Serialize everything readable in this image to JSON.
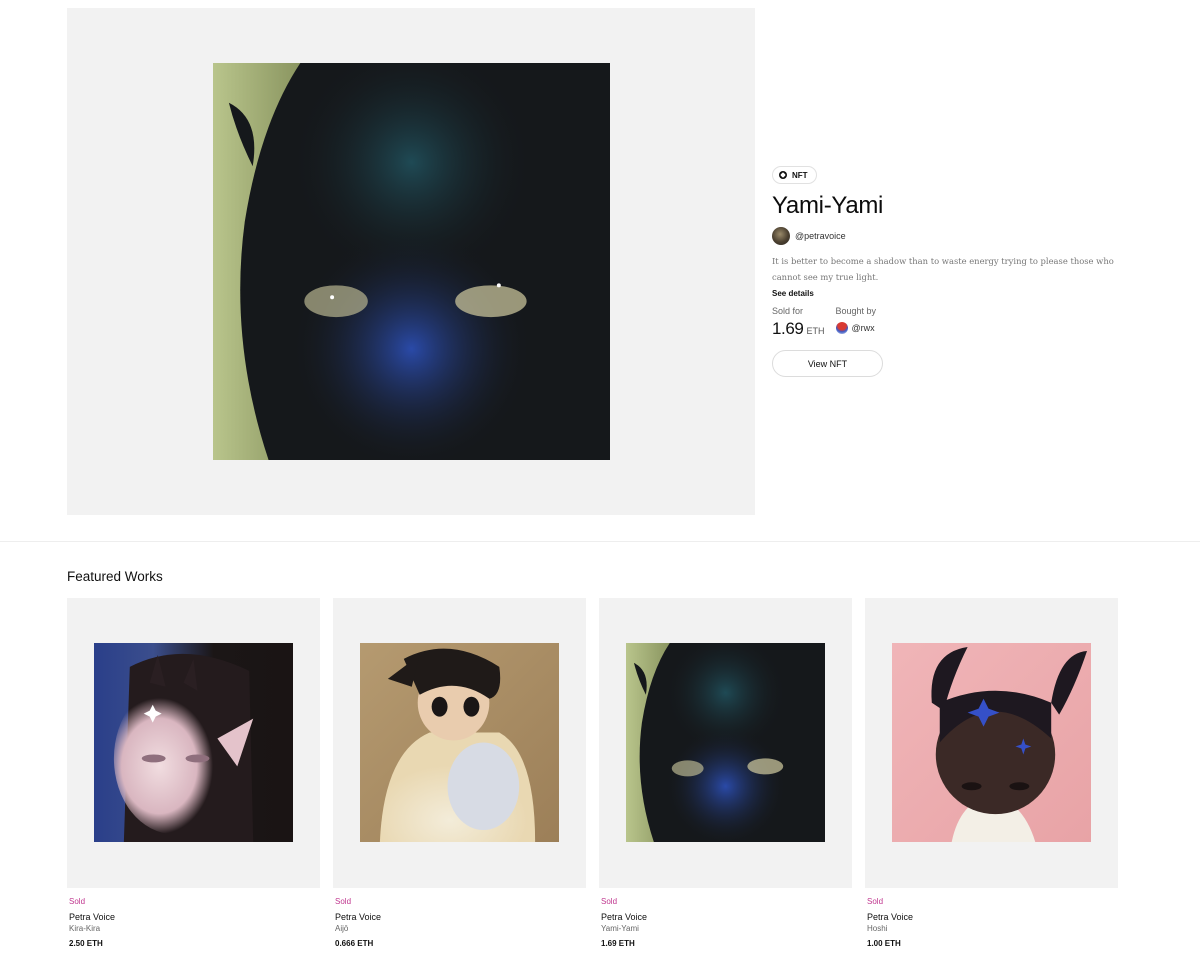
{
  "hero": {
    "badge": "NFT",
    "title": "Yami-Yami",
    "artist_handle": "@petravoice",
    "description": "It is better to become a shadow than to waste energy trying to please those who cannot see my true light.",
    "see_details": "See details",
    "sold_for_label": "Sold for",
    "price_value": "1.69",
    "price_unit": "ETH",
    "bought_by_label": "Bought by",
    "buyer_handle": "@rwx",
    "view_button": "View NFT"
  },
  "featured": {
    "heading": "Featured Works",
    "items": [
      {
        "status": "Sold",
        "artist": "Petra Voice",
        "title": "Kira-Kira",
        "price": "2.50 ETH"
      },
      {
        "status": "Sold",
        "artist": "Petra Voice",
        "title": "Aijō",
        "price": "0.666 ETH"
      },
      {
        "status": "Sold",
        "artist": "Petra Voice",
        "title": "Yami-Yami",
        "price": "1.69 ETH"
      },
      {
        "status": "Sold",
        "artist": "Petra Voice",
        "title": "Hoshi",
        "price": "1.00 ETH"
      }
    ]
  },
  "colors": {
    "accent_sold": "#c0378f",
    "panel_bg": "#f2f2f2"
  }
}
